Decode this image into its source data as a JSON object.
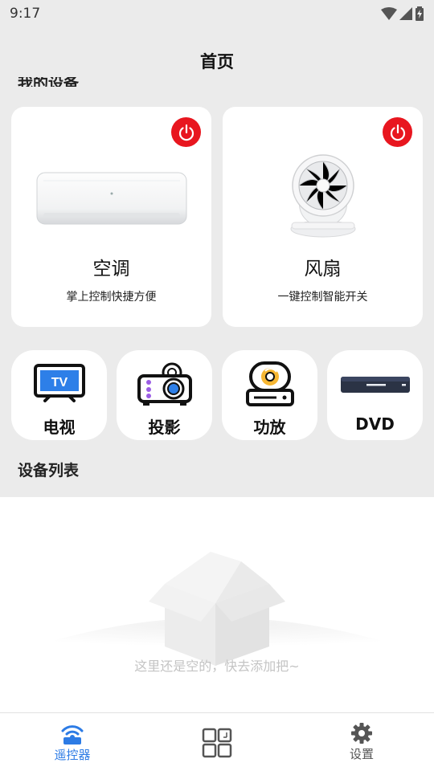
{
  "status": {
    "time": "9:17"
  },
  "header": {
    "title": "首页"
  },
  "section_cut_label": "我的设备",
  "featured": [
    {
      "name": "空调",
      "desc": "掌上控制快捷方便"
    },
    {
      "name": "风扇",
      "desc": "一键控制智能开关"
    }
  ],
  "quick": [
    {
      "label": "电视",
      "icon": "tv-icon"
    },
    {
      "label": "投影",
      "icon": "projector-icon"
    },
    {
      "label": "功放",
      "icon": "amplifier-icon"
    },
    {
      "label": "DVD",
      "icon": "dvd-player-icon"
    }
  ],
  "device_list": {
    "heading": "设备列表",
    "empty_text": "这里还是空的，快去添加把~"
  },
  "bottom_nav": [
    {
      "label": "遥控器",
      "icon": "remote-wifi-icon",
      "active": true
    },
    {
      "label": "",
      "icon": "grid-apps-icon",
      "active": false
    },
    {
      "label": "设置",
      "icon": "gear-icon",
      "active": false
    }
  ],
  "colors": {
    "accent": "#2c7be5",
    "power": "#e8161f",
    "background": "#ebebeb"
  }
}
